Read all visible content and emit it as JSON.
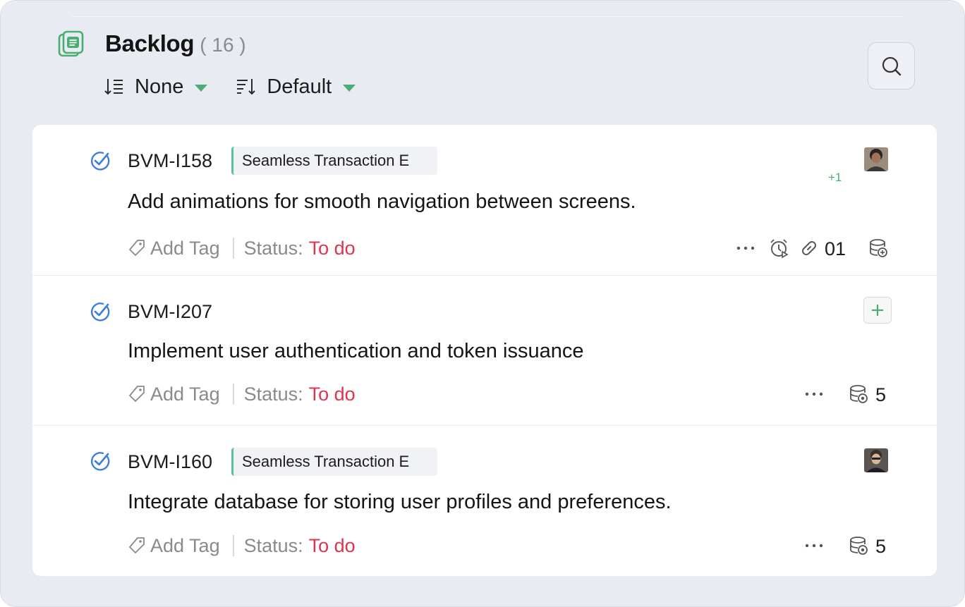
{
  "header": {
    "title": "Backlog",
    "count": "( 16 )",
    "group_by": "None",
    "sort_by": "Default"
  },
  "colors": {
    "accent": "#4cad72",
    "status_todo": "#e0334f",
    "check": "#3b7de0",
    "panel_bg": "#e8ebf2"
  },
  "issues": [
    {
      "id": "BVM-I158",
      "epic": "Seamless Transaction E",
      "summary": "Add animations for smooth navigation between screens.",
      "add_tag": "Add Tag",
      "status_label": "Status:",
      "status": "To do",
      "extra_assignees": "+1",
      "links": "01"
    },
    {
      "id": "BVM-I207",
      "summary": "Implement user authentication and token issuance",
      "add_tag": "Add Tag",
      "status_label": "Status:",
      "status": "To do",
      "points": "5"
    },
    {
      "id": "BVM-I160",
      "epic": "Seamless Transaction E",
      "summary": "Integrate database for storing user profiles and preferences.",
      "add_tag": "Add Tag",
      "status_label": "Status:",
      "status": "To do",
      "points": "5"
    }
  ]
}
